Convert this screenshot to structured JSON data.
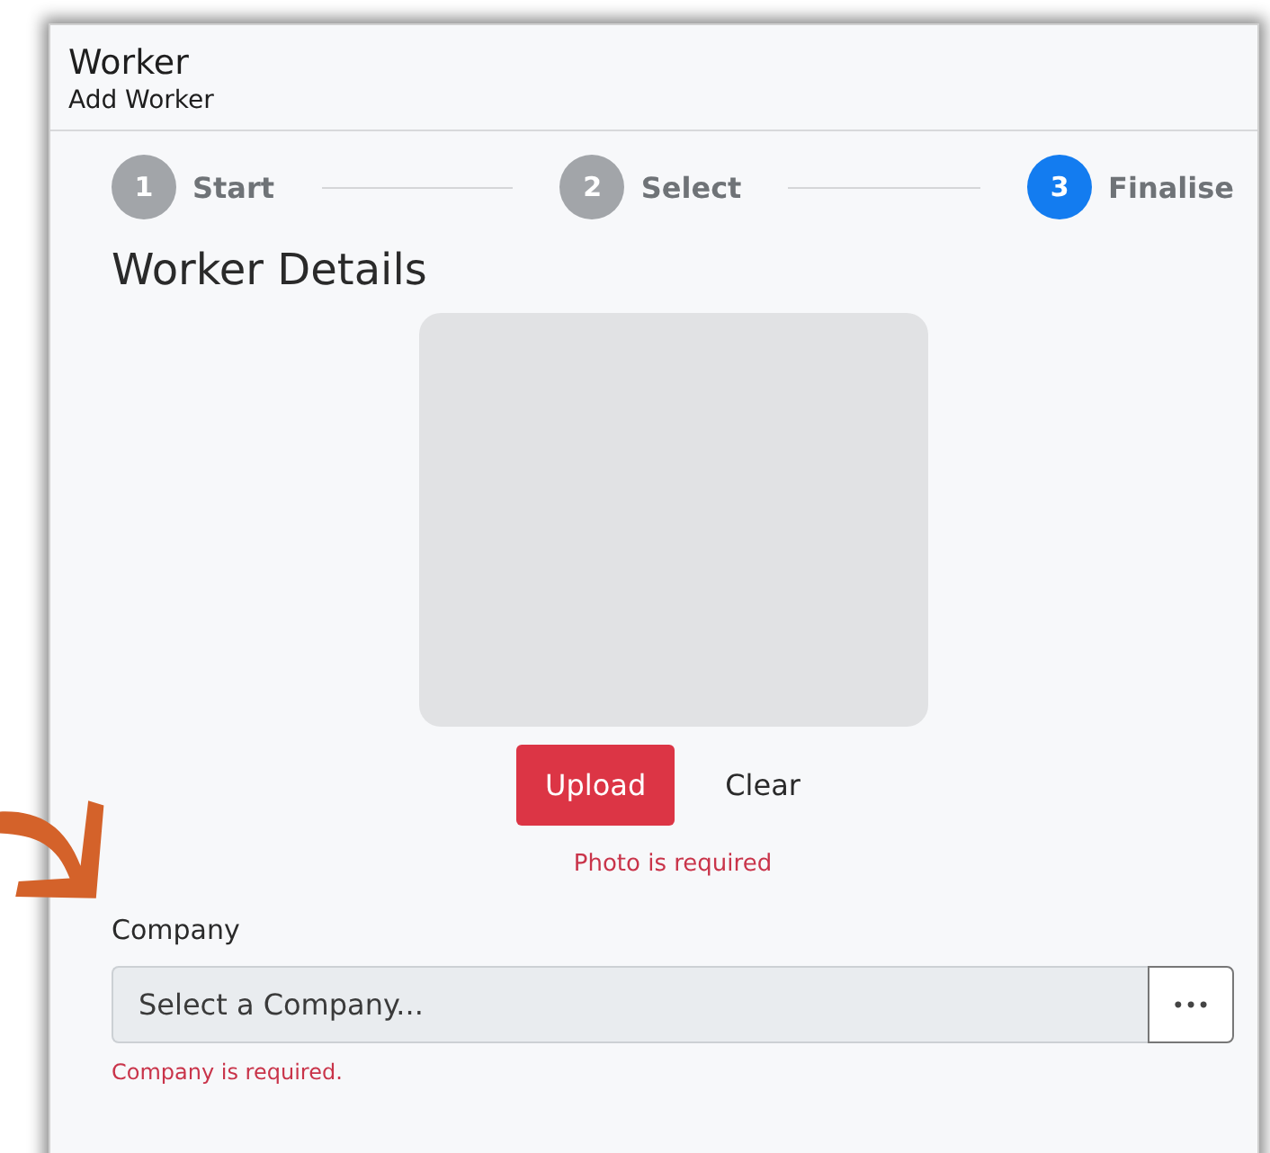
{
  "header": {
    "title": "Worker",
    "subtitle": "Add Worker"
  },
  "steps": [
    {
      "number": "1",
      "label": "Start",
      "selected": false
    },
    {
      "number": "2",
      "label": "Select",
      "selected": false
    },
    {
      "number": "3",
      "label": "Finalise",
      "selected": true
    }
  ],
  "section_title": "Worker Details",
  "photo": {
    "kind": "placeholder",
    "buttons": [
      "Upload",
      "Clear"
    ],
    "error": "Photo is required"
  },
  "company": {
    "label": "Company",
    "placeholder": "Select a Company...",
    "browse_button": "•••",
    "error": "Company is required."
  }
}
